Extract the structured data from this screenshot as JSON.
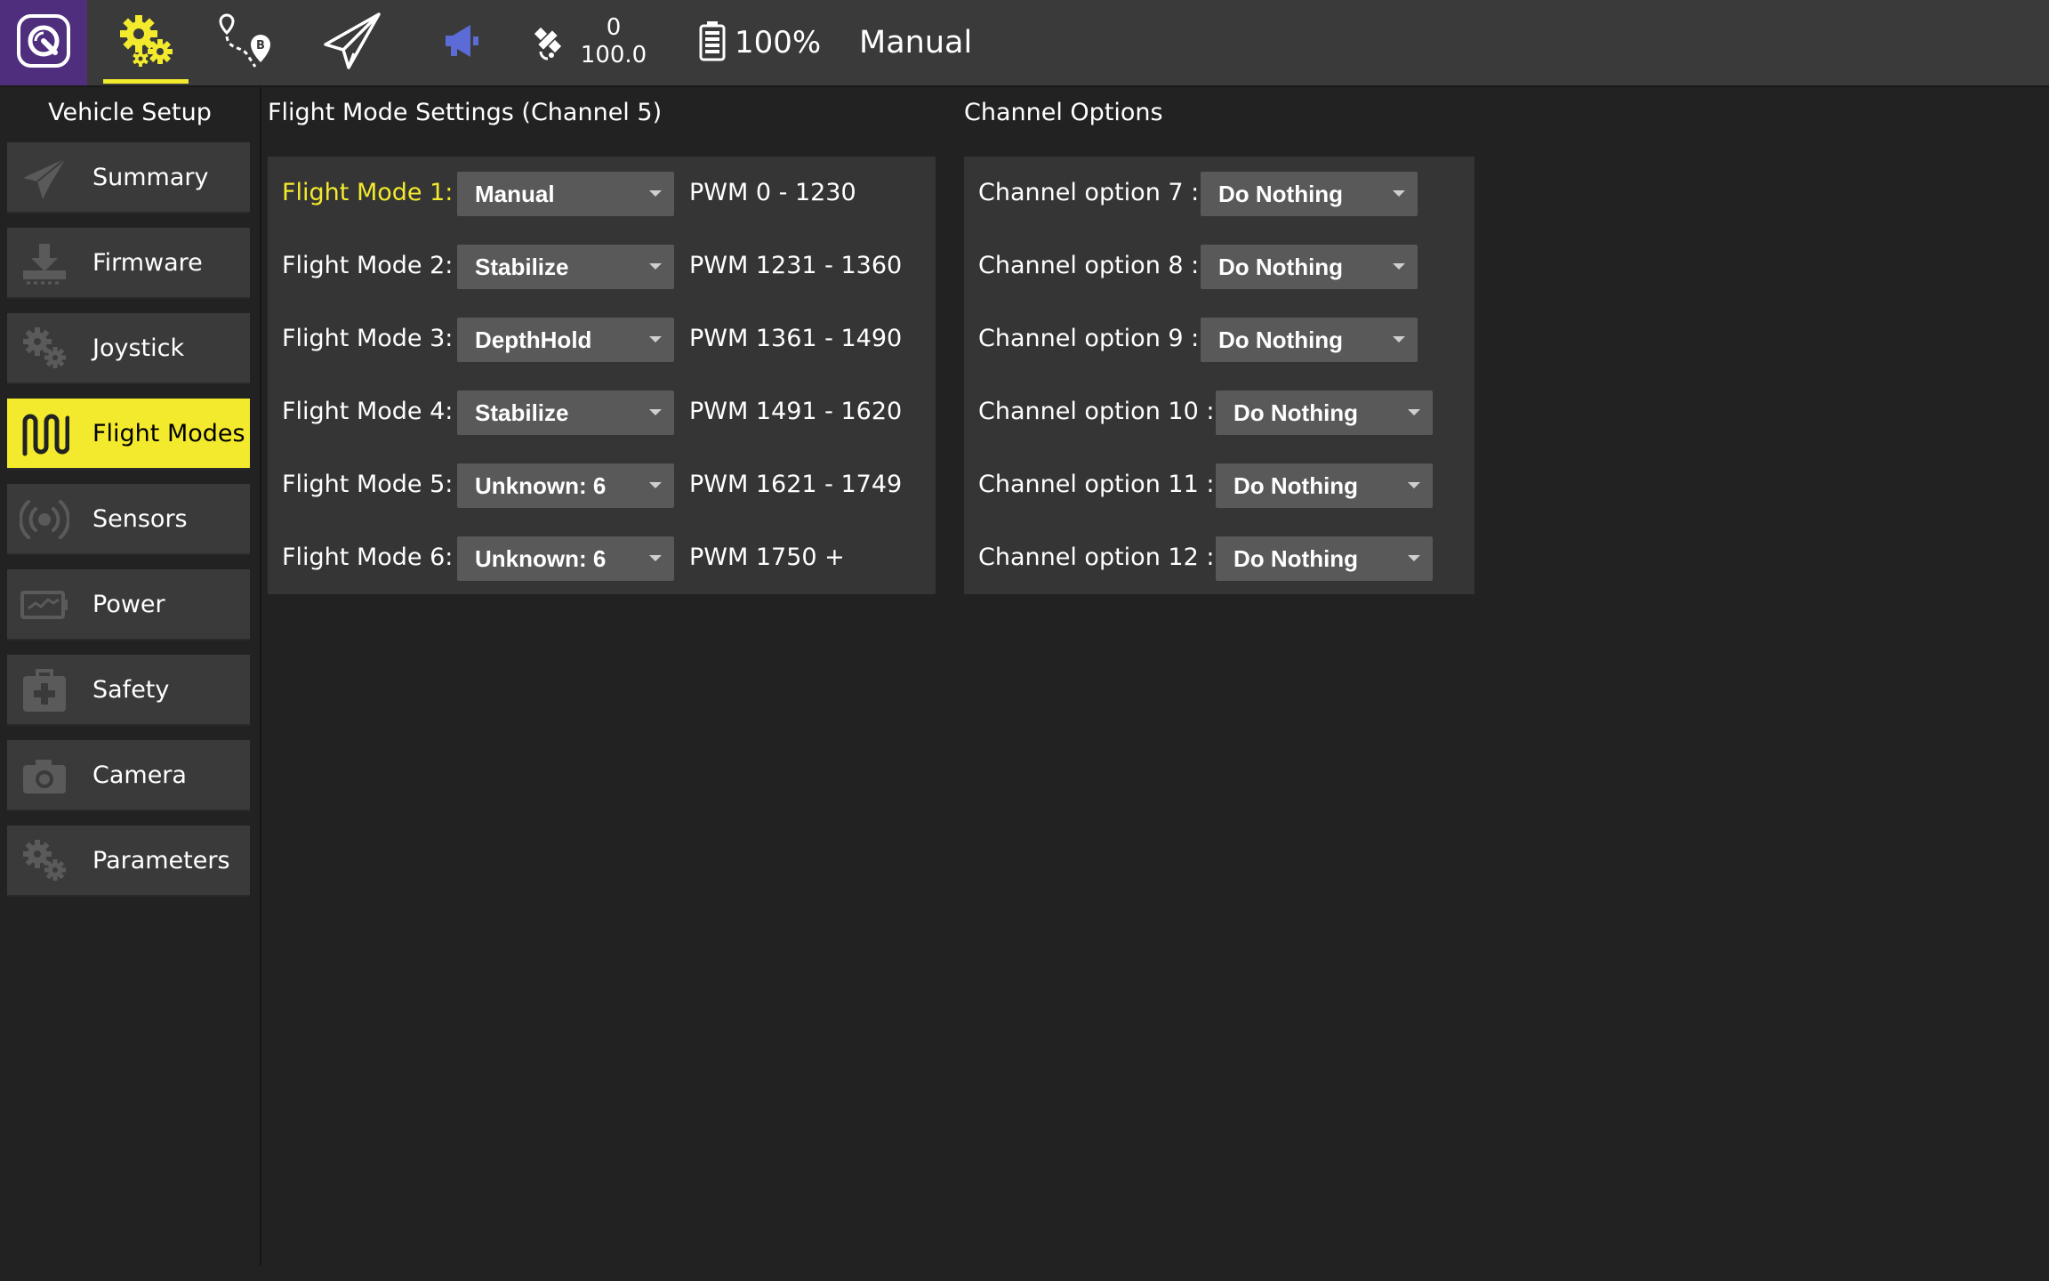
{
  "toolbar": {
    "gps_count": "0",
    "gps_hdop": "100.0",
    "battery": "100%",
    "flight_mode": "Manual",
    "accent_color": "#f3ea2d",
    "logo_bg": "#4f2e7e",
    "icons": [
      "qgc-logo-icon",
      "vehicle-setup-gear-icon",
      "plan-view-icon",
      "fly-view-icon",
      "messages-megaphone-icon",
      "gps-satellite-icon",
      "battery-icon"
    ]
  },
  "sidebar": {
    "title": "Vehicle Setup",
    "items": [
      {
        "label": "Summary",
        "icon": "paper-plane-icon"
      },
      {
        "label": "Firmware",
        "icon": "download-icon"
      },
      {
        "label": "Joystick",
        "icon": "gears-icon"
      },
      {
        "label": "Flight Modes",
        "icon": "flight-modes-wave-icon",
        "active": true
      },
      {
        "label": "Sensors",
        "icon": "sensor-broadcast-icon"
      },
      {
        "label": "Power",
        "icon": "battery-pulse-icon"
      },
      {
        "label": "Safety",
        "icon": "medkit-icon"
      },
      {
        "label": "Camera",
        "icon": "camera-icon"
      },
      {
        "label": "Parameters",
        "icon": "parameters-gears-icon"
      }
    ]
  },
  "flight_modes": {
    "title": "Flight Mode Settings (Channel 5)",
    "rows": [
      {
        "label": "Flight Mode 1:",
        "value": "Manual",
        "pwm": "PWM 0 - 1230",
        "highlighted": true
      },
      {
        "label": "Flight Mode 2:",
        "value": "Stabilize",
        "pwm": "PWM 1231 - 1360"
      },
      {
        "label": "Flight Mode 3:",
        "value": "DepthHold",
        "pwm": "PWM 1361 - 1490"
      },
      {
        "label": "Flight Mode 4:",
        "value": "Stabilize",
        "pwm": "PWM 1491 - 1620"
      },
      {
        "label": "Flight Mode 5:",
        "value": "Unknown: 6",
        "pwm": "PWM 1621 - 1749"
      },
      {
        "label": "Flight Mode 6:",
        "value": "Unknown: 6",
        "pwm": "PWM 1750 +"
      }
    ]
  },
  "channel_options": {
    "title": "Channel Options",
    "rows": [
      {
        "label": "Channel option 7 :",
        "value": "Do Nothing"
      },
      {
        "label": "Channel option 8 :",
        "value": "Do Nothing"
      },
      {
        "label": "Channel option 9 :",
        "value": "Do Nothing"
      },
      {
        "label": "Channel option 10 :",
        "value": "Do Nothing"
      },
      {
        "label": "Channel option 11 :",
        "value": "Do Nothing"
      },
      {
        "label": "Channel option 12 :",
        "value": "Do Nothing"
      }
    ]
  }
}
